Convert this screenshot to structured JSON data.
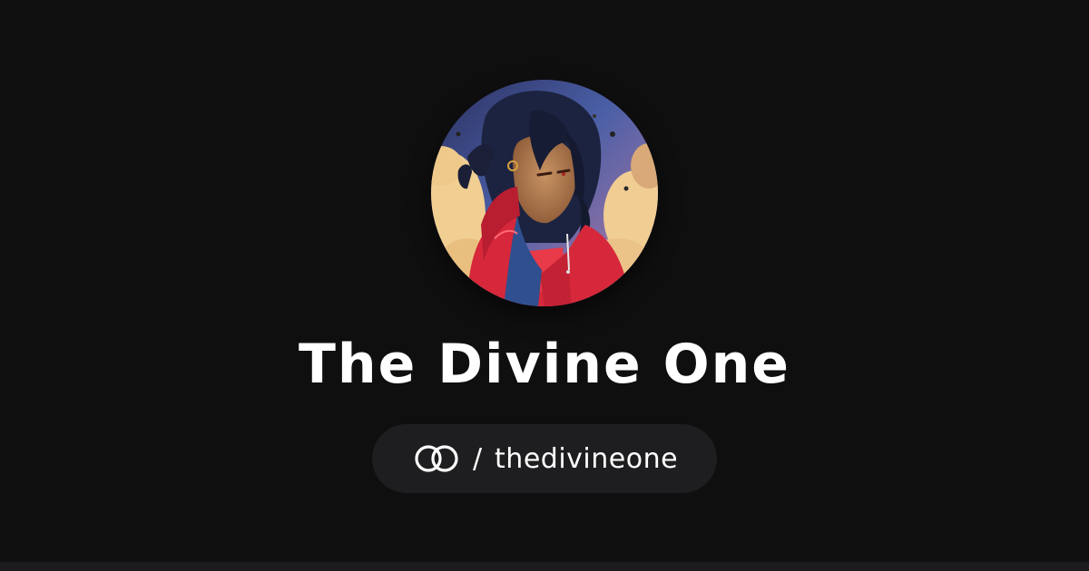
{
  "profile": {
    "name": "The Divine One",
    "avatar_alt": "anime-style portrait avatar",
    "handle_separator": "/",
    "handle": "thedivineone"
  },
  "colors": {
    "background": "#0f0f10",
    "pill_background": "#1e1e20",
    "text": "#ffffff"
  },
  "icons": {
    "brand_logo": "interlocking-circles-icon"
  }
}
